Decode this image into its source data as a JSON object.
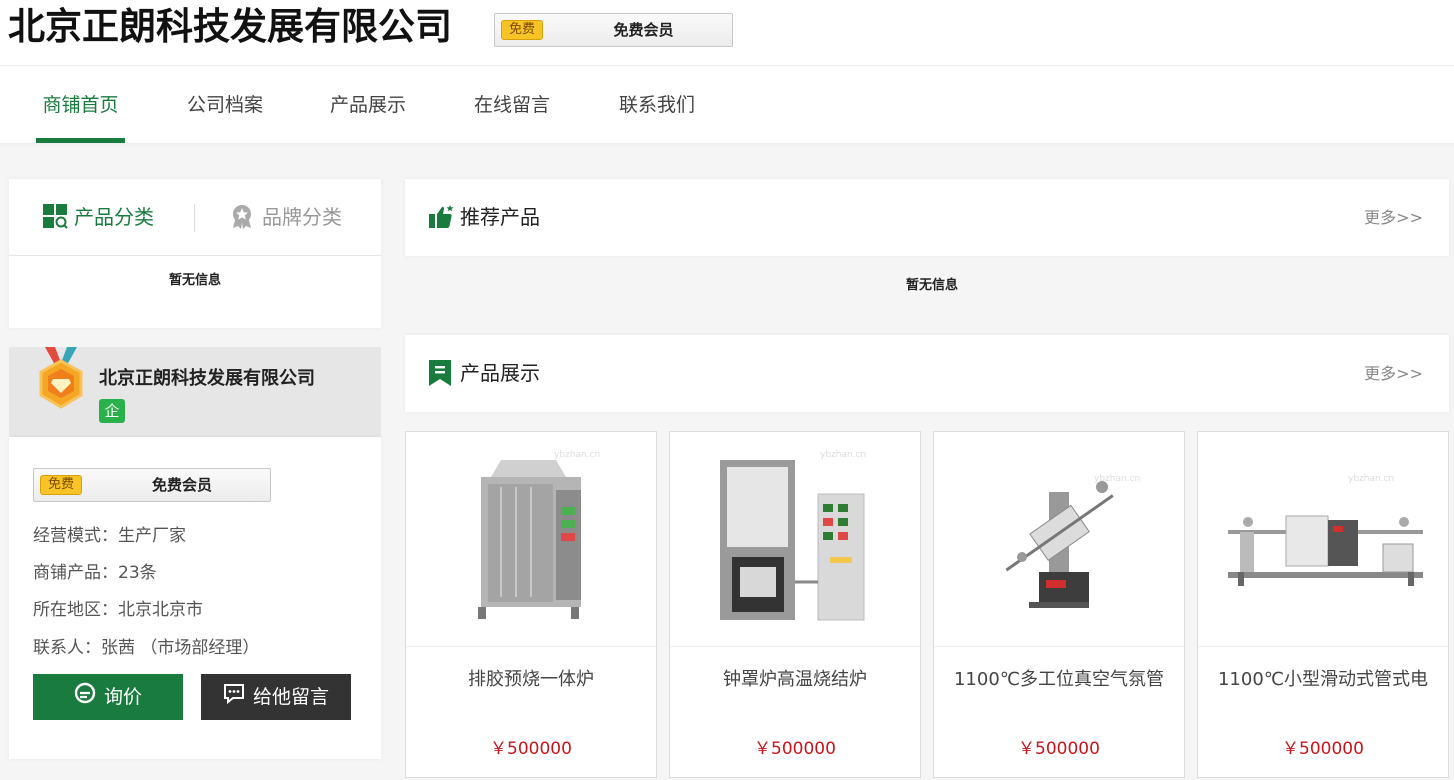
{
  "header": {
    "company_title": "北京正朗科技发展有限公司",
    "member_tag": "免费",
    "member_label": "免费会员"
  },
  "nav": {
    "items": [
      "商铺首页",
      "公司档案",
      "产品展示",
      "在线留言",
      "联系我们"
    ],
    "active_index": 0
  },
  "category_panel": {
    "tab_product": "产品分类",
    "tab_brand": "品牌分类",
    "empty": "暂无信息"
  },
  "company_card": {
    "name": "北京正朗科技发展有限公司",
    "qi_badge": "企",
    "member_tag": "免费",
    "member_label": "免费会员",
    "info": [
      {
        "label": "经营模式：",
        "value": "生产厂家"
      },
      {
        "label": "商铺产品：",
        "value": "23条"
      },
      {
        "label": "所在地区：",
        "value": "北京北京市"
      },
      {
        "label": "联系人：",
        "value": "张茜 （市场部经理）"
      }
    ],
    "btn_inquiry": "询价",
    "btn_message": "给他留言"
  },
  "recommended": {
    "title": "推荐产品",
    "more": "更多>>",
    "empty": "暂无信息"
  },
  "products_section": {
    "title": "产品展示",
    "more": "更多>>",
    "items": [
      {
        "name": "排胶预烧一体炉",
        "price": "￥500000"
      },
      {
        "name": "钟罩炉高温烧结炉",
        "price": "￥500000"
      },
      {
        "name": "1100℃多工位真空气氛管",
        "price": "￥500000"
      },
      {
        "name": "1100℃小型滑动式管式电",
        "price": "￥500000"
      }
    ]
  },
  "colors": {
    "brand_green": "#1a7b3f",
    "price_red": "#c8161d",
    "dark_button": "#333333",
    "badge_yellow": "#f7c325"
  },
  "icons": [
    "grid-search-icon",
    "award-icon",
    "medal-icon",
    "thumbs-up-icon",
    "bookmark-icon",
    "chat-icon",
    "message-icon"
  ]
}
